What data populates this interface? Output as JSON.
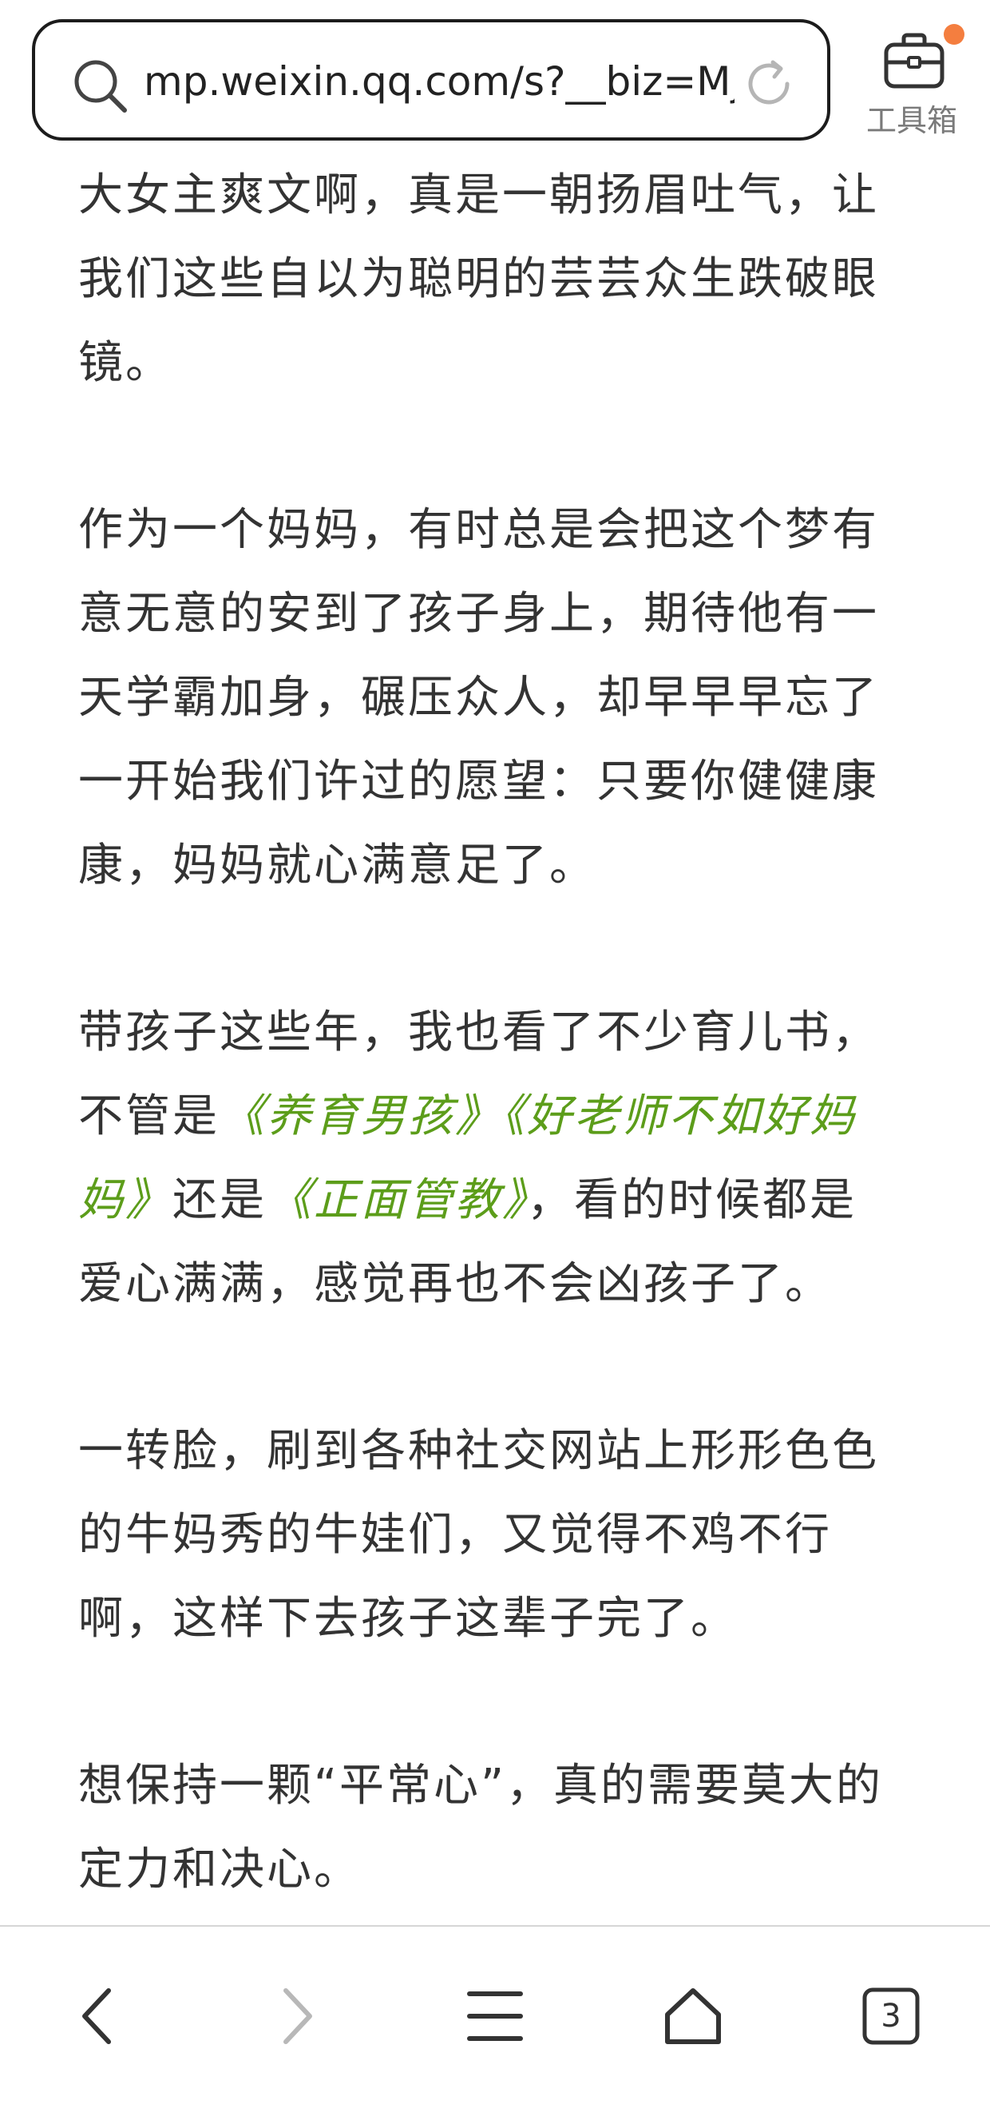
{
  "browser": {
    "url": "mp.weixin.qq.com/s?__biz=Mj…",
    "toolbox_label": "工具箱",
    "tab_count": "3",
    "accent_dot_color": "#f47e3f"
  },
  "article": {
    "paragraphs": [
      {
        "text": "大女主爽文啊，真是一朝扬眉吐气，让我们这些自以为聪明的芸芸众生跌破眼镜。"
      },
      {
        "text": "作为一个妈妈，有时总是会把这个梦有意无意的安到了孩子身上，期待他有一天学霸加身，碾压众人，却早早早忘了一开始我们许过的愿望：只要你健健康康，妈妈就心满意足了。"
      },
      {
        "p1": "带孩子这些年，我也看了不少育儿书，不管是",
        "book1": "《养育男孩》《好老师不如好妈妈》",
        "p2": "还是",
        "book2": "《正面管教》",
        "p3": "，看的时候都是爱心满满，感觉再也不会凶孩子了。",
        "book_color": "#5c9d1a"
      },
      {
        "text": "一转脸，刷到各种社交网站上形形色色的牛妈秀的牛娃们，又觉得不鸡不行啊，这样下去孩子这辈子完了。"
      },
      {
        "text": "想保持一颗“平常心”，真的需要莫大的定力和决心。"
      }
    ]
  },
  "bottom_nav": {
    "items": [
      "back-icon",
      "forward-icon",
      "menu-icon",
      "home-icon",
      "tabs-icon"
    ]
  }
}
